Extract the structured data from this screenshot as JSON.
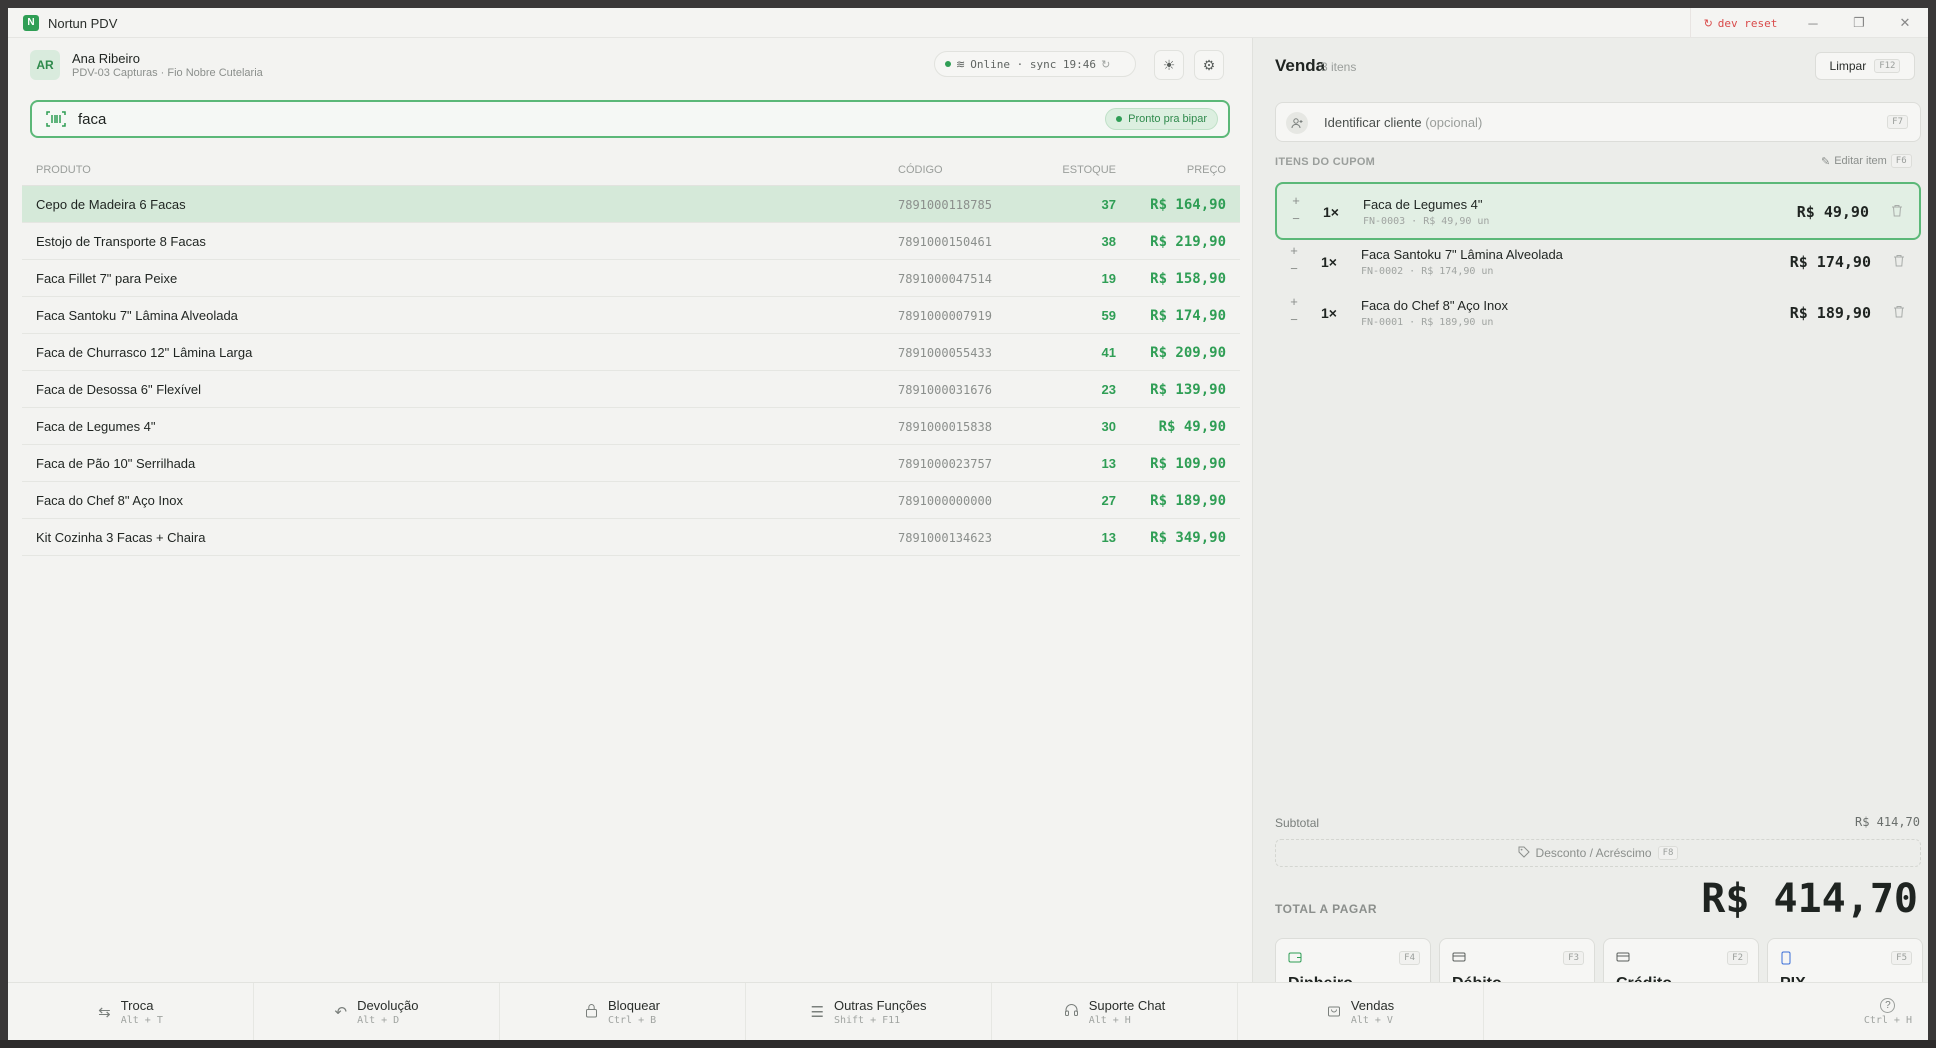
{
  "window": {
    "logo": "N",
    "title": "Nortun PDV",
    "dev_reset": "dev reset"
  },
  "header": {
    "avatar": "AR",
    "user_name": "Ana Ribeiro",
    "user_sub": "PDV-03 Capturas · Fio Nobre Cutelaria",
    "status": "Online · sync 19:46"
  },
  "search": {
    "value": "faca",
    "badge": "Pronto pra bipar"
  },
  "table": {
    "headers": {
      "product": "PRODUTO",
      "code": "CÓDIGO",
      "stock": "ESTOQUE",
      "price": "PREÇO"
    },
    "rows": [
      {
        "name": "Cepo de Madeira 6 Facas",
        "code": "7891000118785",
        "stock": "37",
        "price": "R$ 164,90"
      },
      {
        "name": "Estojo de Transporte 8 Facas",
        "code": "7891000150461",
        "stock": "38",
        "price": "R$ 219,90"
      },
      {
        "name": "Faca Fillet 7\" para Peixe",
        "code": "7891000047514",
        "stock": "19",
        "price": "R$ 158,90"
      },
      {
        "name": "Faca Santoku 7\" Lâmina Alveolada",
        "code": "7891000007919",
        "stock": "59",
        "price": "R$ 174,90"
      },
      {
        "name": "Faca de Churrasco 12\" Lâmina Larga",
        "code": "7891000055433",
        "stock": "41",
        "price": "R$ 209,90"
      },
      {
        "name": "Faca de Desossa 6\" Flexível",
        "code": "7891000031676",
        "stock": "23",
        "price": "R$ 139,90"
      },
      {
        "name": "Faca de Legumes 4\"",
        "code": "7891000015838",
        "stock": "30",
        "price": "R$ 49,90"
      },
      {
        "name": "Faca de Pão 10\" Serrilhada",
        "code": "7891000023757",
        "stock": "13",
        "price": "R$ 109,90"
      },
      {
        "name": "Faca do Chef 8\" Aço Inox",
        "code": "7891000000000",
        "stock": "27",
        "price": "R$ 189,90"
      },
      {
        "name": "Kit Cozinha 3 Facas + Chaira",
        "code": "7891000134623",
        "stock": "13",
        "price": "R$ 349,90"
      }
    ]
  },
  "sale": {
    "title": "Venda",
    "count": "3 itens",
    "clear_label": "Limpar",
    "clear_key": "F12",
    "client_label": "Identificar cliente",
    "client_optional": "(opcional)",
    "client_key": "F7",
    "items_header": "ITENS DO CUPOM",
    "edit_label": "Editar item",
    "edit_key": "F6",
    "items": [
      {
        "qty": "1×",
        "name": "Faca de Legumes 4\"",
        "sub": "FN-0003 · R$ 49,90 un",
        "price": "R$ 49,90"
      },
      {
        "qty": "1×",
        "name": "Faca Santoku 7\" Lâmina Alveolada",
        "sub": "FN-0002 · R$ 174,90 un",
        "price": "R$ 174,90"
      },
      {
        "qty": "1×",
        "name": "Faca do Chef 8\" Aço Inox",
        "sub": "FN-0001 · R$ 189,90 un",
        "price": "R$ 189,90"
      }
    ],
    "subtotal_label": "Subtotal",
    "subtotal_value": "R$ 414,70",
    "discount_label": "Desconto / Acréscimo",
    "discount_key": "F8",
    "total_label": "TOTAL A PAGAR",
    "total_value": "R$ 414,70"
  },
  "payments": [
    {
      "label": "Dinheiro",
      "key": "F4"
    },
    {
      "label": "Débito",
      "key": "F3"
    },
    {
      "label": "Crédito",
      "key": "F2"
    },
    {
      "label": "PIX",
      "key": "F5"
    }
  ],
  "bottombar": [
    {
      "label": "Troca",
      "key": "Alt + T"
    },
    {
      "label": "Devolução",
      "key": "Alt + D"
    },
    {
      "label": "Bloquear",
      "key": "Ctrl + B"
    },
    {
      "label": "Outras Funções",
      "key": "Shift + F11"
    },
    {
      "label": "Suporte Chat",
      "key": "Alt + H"
    },
    {
      "label": "Vendas",
      "key": "Alt + V"
    },
    {
      "label": "",
      "key": "Ctrl + H"
    }
  ],
  "colors": {
    "accent": "#2f9e55",
    "selected_row": "#d5e9d9",
    "danger": "#d94a4a"
  }
}
